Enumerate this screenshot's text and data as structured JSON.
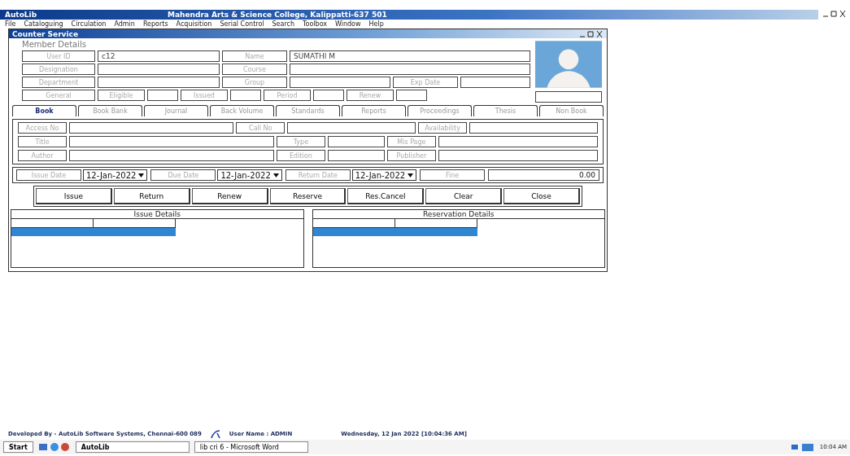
{
  "app": {
    "title": "AutoLib",
    "college": "Mahendra Arts & Science College, Kalippatti-637 501"
  },
  "menu": [
    "File",
    "Cataloguing",
    "Circulation",
    "Admin",
    "Reports",
    "Acquisition",
    "Serial Control",
    "Search",
    "Toolbox",
    "Window",
    "Help"
  ],
  "window": {
    "title": "Counter Service"
  },
  "member": {
    "title": "Member Details",
    "rows": [
      [
        {
          "label": "User ID",
          "value": "c12"
        },
        {
          "label": "Name",
          "value": "SUMATHI M"
        }
      ],
      [
        {
          "label": "Designation"
        },
        {
          "label": "Course"
        }
      ],
      [
        {
          "label": "Department"
        },
        {
          "label": "Group"
        },
        {
          "label": "Exp Date"
        }
      ]
    ],
    "counts": [
      {
        "label": "General"
      },
      {
        "label": "Eligible"
      },
      {
        "label": "Issued"
      },
      {
        "label": "Period"
      },
      {
        "label": "Renew"
      }
    ]
  },
  "tabs": [
    {
      "label": "Book",
      "selected": true
    },
    {
      "label": "Book Bank",
      "selected": false
    },
    {
      "label": "Journal",
      "selected": false
    },
    {
      "label": "Back Volume",
      "selected": false
    },
    {
      "label": "Standards",
      "selected": false
    },
    {
      "label": "Reports",
      "selected": false
    },
    {
      "label": "Proceedings",
      "selected": false
    },
    {
      "label": "Thesis",
      "selected": false
    },
    {
      "label": "Non Book",
      "selected": false
    }
  ],
  "book_rows": [
    [
      {
        "label": "Access No"
      },
      {
        "label": "Call No"
      },
      {
        "label": "Availability"
      }
    ],
    [
      {
        "label": "Title"
      },
      {
        "label": "Type"
      },
      {
        "label": "Mis Page"
      }
    ],
    [
      {
        "label": "Author"
      },
      {
        "label": "Edition"
      },
      {
        "label": "Publisher"
      }
    ]
  ],
  "dates": [
    {
      "label": "Issue Date",
      "value": "12-Jan-2022"
    },
    {
      "label": "Due Date",
      "value": "12-Jan-2022"
    },
    {
      "label": "Return Date",
      "value": "12-Jan-2022"
    }
  ],
  "fine": {
    "label": "Fine",
    "value": "0.00"
  },
  "buttons": [
    "Issue",
    "Return",
    "Renew",
    "Reserve",
    "Res.Cancel",
    "Clear",
    "Close"
  ],
  "grids": [
    {
      "title": "Issue Details"
    },
    {
      "title": "Reservation Details"
    }
  ],
  "status_bar": {
    "developer": "Developed By -  AutoLib Software Systems, Chennai-600 089",
    "user": "User Name : ADMIN",
    "datetime": "Wednesday, 12 Jan 2022 [10:04:36 AM]"
  },
  "taskbar": {
    "start": "Start",
    "tasks": [
      "AutoLib",
      "lib cri 6 - Microsoft Word"
    ],
    "clock": "10:04 AM"
  }
}
